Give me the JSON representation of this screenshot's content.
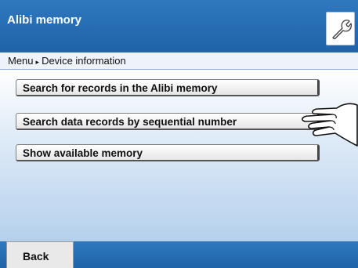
{
  "window": {
    "title": "Alibi memory",
    "settings_icon": "wrench-icon"
  },
  "breadcrumb": {
    "items": [
      "Menu",
      "Device information"
    ],
    "separator": "▸"
  },
  "menu": {
    "items": [
      {
        "label": "Search for records in the Alibi memory"
      },
      {
        "label": "Search data records by sequential number"
      },
      {
        "label": "Show available memory"
      }
    ]
  },
  "footer": {
    "back_label": "Back"
  },
  "pointer": {
    "icon": "pointing-hand-icon"
  }
}
